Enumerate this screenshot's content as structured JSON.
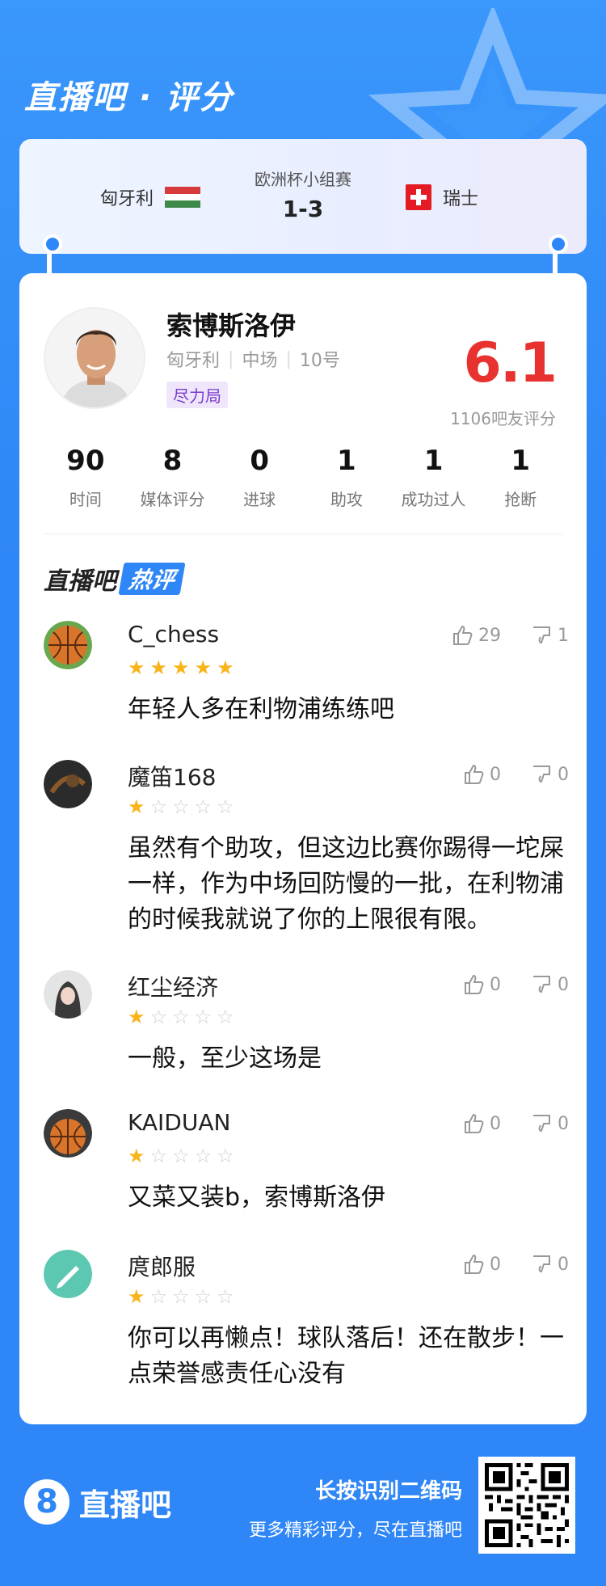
{
  "brand": {
    "title": "直播吧 · 评分"
  },
  "match": {
    "competition": "欧洲杯小组赛",
    "score": "1-3",
    "home_team": "匈牙利",
    "away_team": "瑞士"
  },
  "player": {
    "name": "索博斯洛伊",
    "team": "匈牙利",
    "position": "中场",
    "number": "10号",
    "badge": "尽力局",
    "rating": "6.1",
    "rating_count": "1106吧友评分"
  },
  "stats": [
    {
      "value": "90",
      "label": "时间"
    },
    {
      "value": "8",
      "label": "媒体评分"
    },
    {
      "value": "0",
      "label": "进球"
    },
    {
      "value": "1",
      "label": "助攻"
    },
    {
      "value": "1",
      "label": "成功过人"
    },
    {
      "value": "1",
      "label": "抢断"
    }
  ],
  "hot_section": {
    "prefix": "直播吧",
    "tag": "热评"
  },
  "comments": [
    {
      "user": "C_chess",
      "stars": 5,
      "likes": "29",
      "dislikes": "1",
      "text": "年轻人多在利物浦练练吧",
      "avatar_icon": "basketball-icon"
    },
    {
      "user": "魔笛168",
      "stars": 1,
      "likes": "0",
      "dislikes": "0",
      "text": "虽然有个助攻，但这边比赛你踢得一坨屎一样，作为中场回防慢的一批，在利物浦的时候我就说了你的上限很有限。",
      "avatar_icon": "dark-avatar-icon"
    },
    {
      "user": "红尘经济",
      "stars": 1,
      "likes": "0",
      "dislikes": "0",
      "text": "一般，至少这场是",
      "avatar_icon": "portrait-avatar-icon"
    },
    {
      "user": "KAIDUAN",
      "stars": 1,
      "likes": "0",
      "dislikes": "0",
      "text": "又菜又装b，索博斯洛伊",
      "avatar_icon": "basketball-icon"
    },
    {
      "user": "庹郎服",
      "stars": 1,
      "likes": "0",
      "dislikes": "0",
      "text": "你可以再懒点！球队落后！还在散步！一点荣誉感责任心没有",
      "avatar_icon": "pen-avatar-icon"
    }
  ],
  "footer": {
    "logo_number": "8",
    "logo_text": "直播吧",
    "cta_title": "长按识别二维码",
    "cta_sub": "更多精彩评分，尽在直播吧"
  },
  "colors": {
    "background": "#2f86f6",
    "rating": "#e8322f",
    "star": "#f8b418",
    "badge": "#7a3ccf"
  }
}
